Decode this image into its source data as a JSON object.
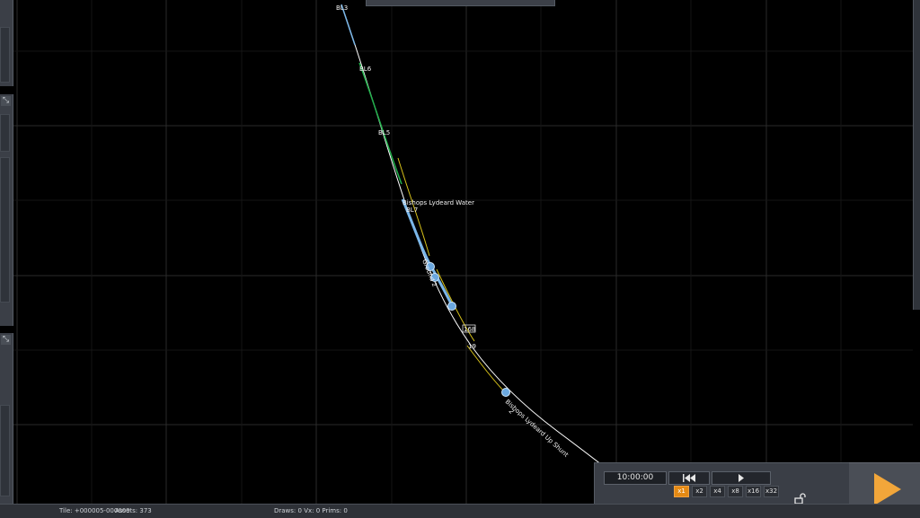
{
  "status_bar": {
    "tile": "Tile: +000005-000009",
    "assets": "Assets: 373",
    "stats": "Draws: 0 Vx: 0 Prims: 0"
  },
  "playback": {
    "time": "10:00:00",
    "rewind_icon": "skip-back-icon",
    "play_icon": "play-icon",
    "speeds": [
      "x1",
      "x2",
      "x4",
      "x8",
      "x16",
      "x32"
    ],
    "active_speed": "x1"
  },
  "map": {
    "labels": {
      "station": "Bishops Lydeard Water",
      "shunt": "Bishops Lydeard Up Shunt",
      "ground2": "Ground 2",
      "signal_2": "2",
      "b13": "BL3",
      "b16": "BL6",
      "b15": "BL5",
      "b17": "BL7",
      "m168": "168",
      "m19": "19"
    }
  },
  "icons": {
    "lock": "unlock-icon",
    "go": "play-large-icon",
    "panel_knob": "move-icon"
  },
  "colors": {
    "accent": "#e58a14",
    "track_main": "#ffffff",
    "track_yellow": "#d8c21a",
    "track_green": "#22b14c",
    "track_blue": "#7ab6e8"
  }
}
